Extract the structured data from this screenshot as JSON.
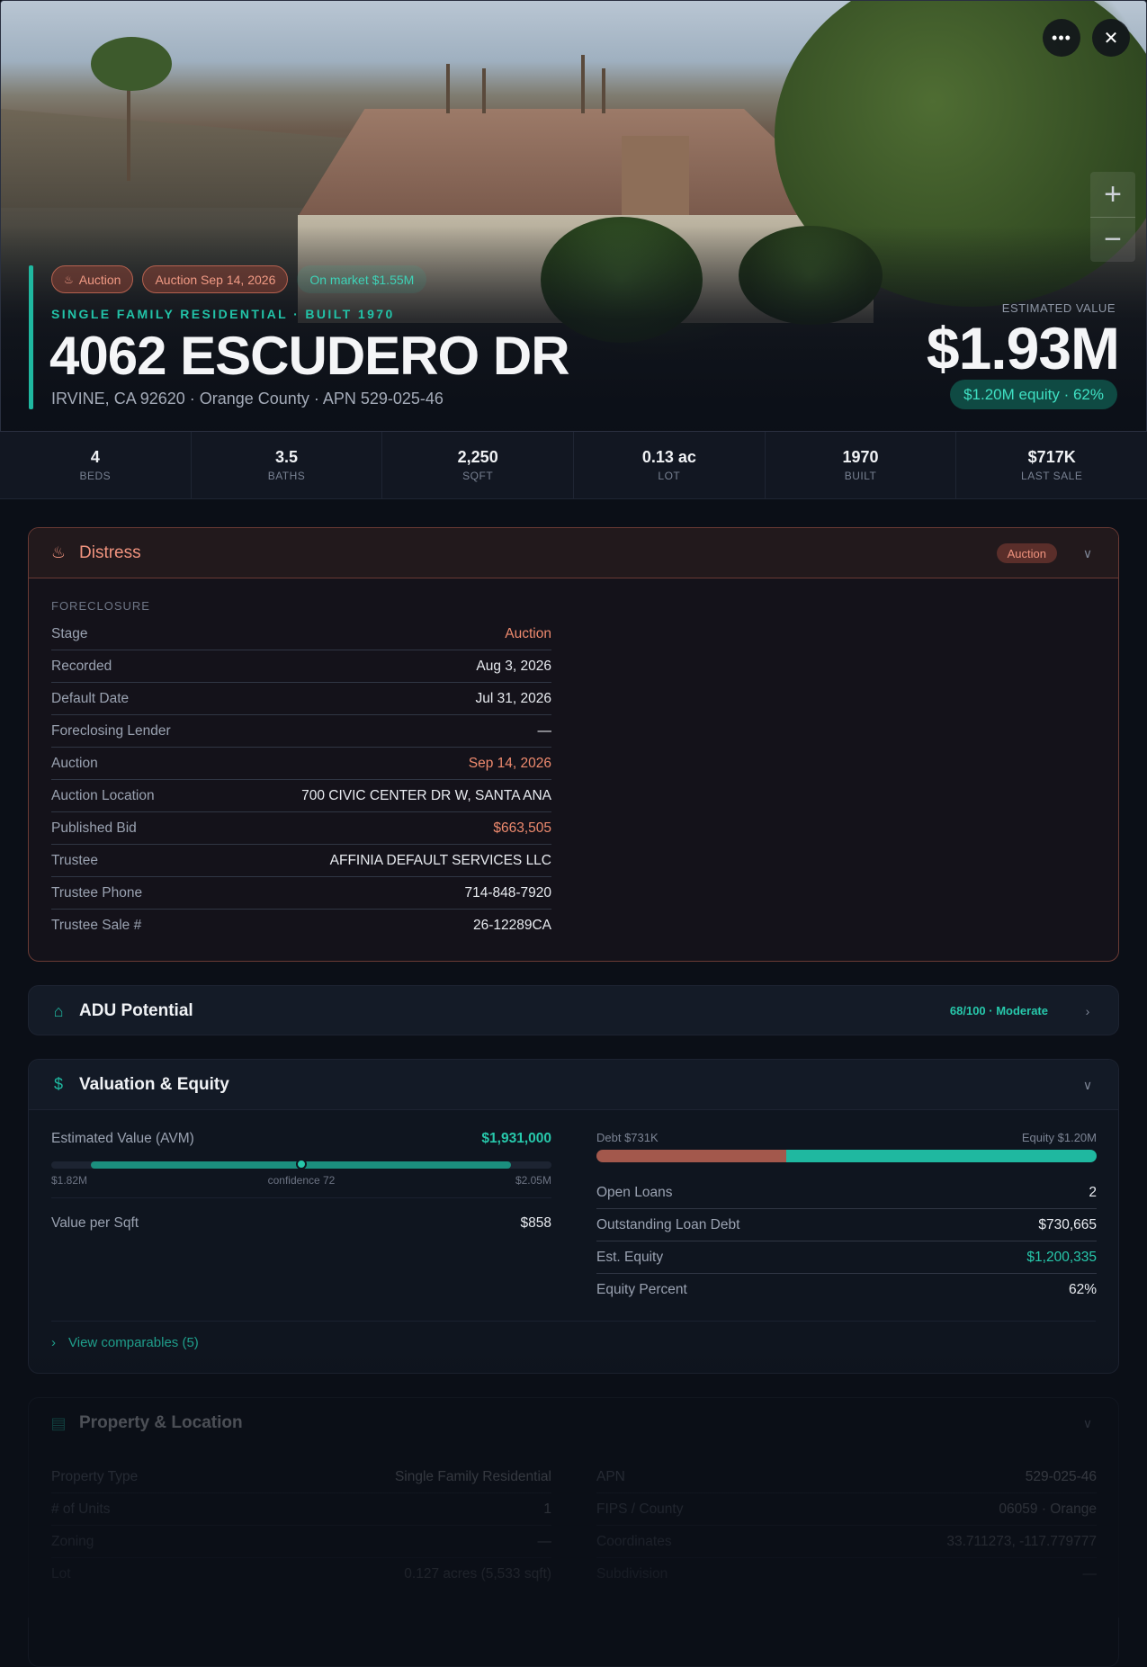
{
  "hero": {
    "chips": [
      {
        "label": "Auction",
        "style": "red",
        "icon": "flame-icon"
      },
      {
        "label": "Auction Sep 14, 2026",
        "style": "red"
      },
      {
        "label": "On market $1.55M",
        "style": "teal"
      }
    ],
    "subtitle": "SINGLE FAMILY RESIDENTIAL · BUILT 1970",
    "title": "4062 ESCUDERO DR",
    "address_line": "IRVINE, CA 92620 · Orange County · APN 529-025-46",
    "estimated_label": "ESTIMATED VALUE",
    "estimated_value": "$1.93M",
    "equity_pill": "$1.20M equity · 62%",
    "more_icon": "more-horizontal-icon",
    "close_icon": "close-icon"
  },
  "stats": [
    {
      "value": "4",
      "label": "BEDS"
    },
    {
      "value": "3.5",
      "label": "BATHS"
    },
    {
      "value": "2,250",
      "label": "SQFT"
    },
    {
      "value": "0.13 ac",
      "label": "LOT"
    },
    {
      "value": "1970",
      "label": "BUILT"
    },
    {
      "value": "$717K",
      "label": "LAST SALE"
    }
  ],
  "distress": {
    "title": "Distress",
    "badge": "Auction",
    "section_label": "FORECLOSURE",
    "rows": [
      {
        "key": "Stage",
        "value": "Auction",
        "tone": "red"
      },
      {
        "key": "Recorded",
        "value": "Aug 3, 2026",
        "tone": ""
      },
      {
        "key": "Default Date",
        "value": "Jul 31, 2026",
        "tone": ""
      },
      {
        "key": "Foreclosing Lender",
        "value": "—",
        "tone": ""
      },
      {
        "key": "Auction",
        "value": "Sep 14, 2026",
        "tone": "red"
      },
      {
        "key": "Auction Location",
        "value": "700 CIVIC CENTER DR W, SANTA ANA",
        "tone": ""
      },
      {
        "key": "Published Bid",
        "value": "$663,505",
        "tone": "red"
      },
      {
        "key": "Trustee",
        "value": "AFFINIA DEFAULT SERVICES LLC",
        "tone": ""
      },
      {
        "key": "Trustee Phone",
        "value": "714-848-7920",
        "tone": ""
      },
      {
        "key": "Trustee Sale #",
        "value": "26-12289CA",
        "tone": ""
      }
    ]
  },
  "adu": {
    "title": "ADU Potential",
    "score": "68/100 · Moderate"
  },
  "valuation": {
    "title": "Valuation & Equity",
    "avm_label": "Estimated Value (AVM)",
    "avm_value": "$1,931,000",
    "avm_low": "$1.82M",
    "avm_confidence": "confidence 72",
    "avm_high": "$2.05M",
    "avm_position": 0.5,
    "value_per_sqft_label": "Value per Sqft",
    "value_per_sqft": "$858",
    "debt_label": "Debt $731K",
    "equity_label": "Equity $1.20M",
    "debt_fraction": 0.38,
    "rows": [
      {
        "key": "Open Loans",
        "value": "2",
        "tone": ""
      },
      {
        "key": "Outstanding Loan Debt",
        "value": "$730,665",
        "tone": ""
      },
      {
        "key": "Est. Equity",
        "value": "$1,200,335",
        "tone": "teal"
      },
      {
        "key": "Equity Percent",
        "value": "62%",
        "tone": ""
      }
    ],
    "comparables": "View comparables (5)"
  },
  "property": {
    "title": "Property & Location",
    "left_rows": [
      {
        "key": "Property Type",
        "value": "Single Family Residential"
      },
      {
        "key": "# of Units",
        "value": "1"
      },
      {
        "key": "Zoning",
        "value": "—"
      },
      {
        "key": "Lot",
        "value": "0.127 acres (5,533 sqft)"
      }
    ],
    "right_rows": [
      {
        "key": "APN",
        "value": "529-025-46"
      },
      {
        "key": "FIPS / County",
        "value": "06059 · Orange"
      },
      {
        "key": "Coordinates",
        "value": "33.711273, -117.779777"
      },
      {
        "key": "Subdivision",
        "value": "—"
      }
    ]
  },
  "colors": {
    "accent": "#1fb8a0",
    "distress": "#f0937e",
    "background": "#0b0f17"
  }
}
